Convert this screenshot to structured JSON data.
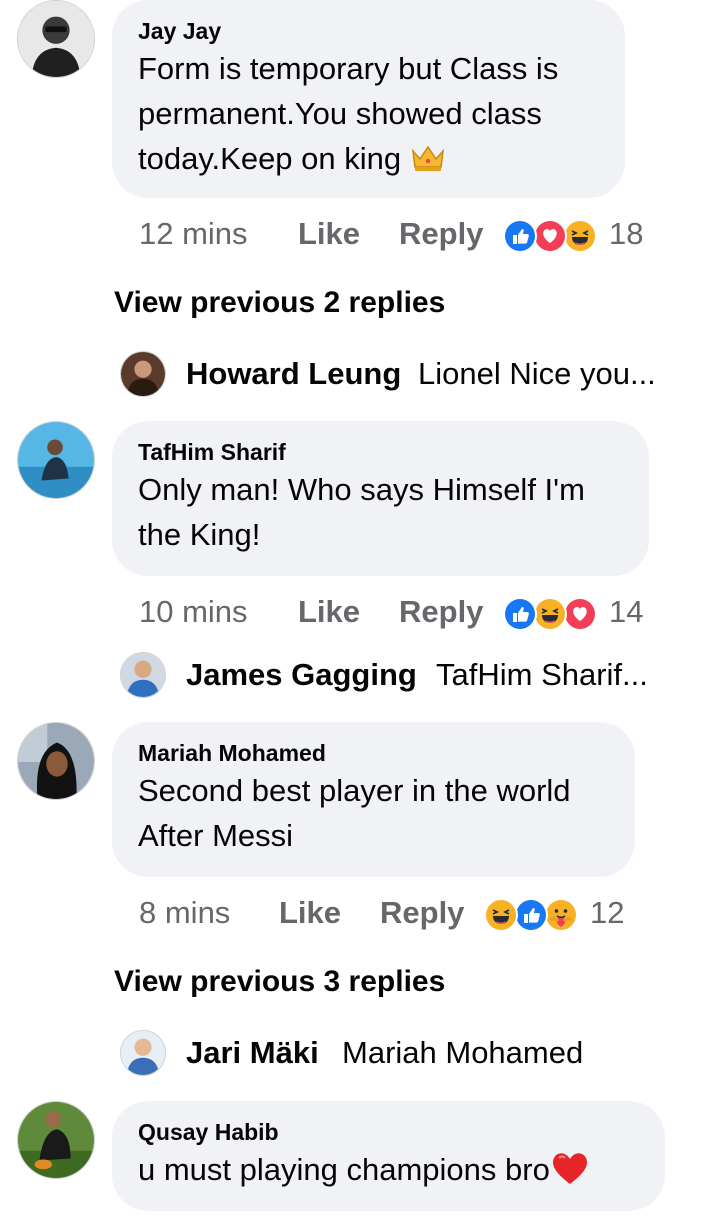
{
  "comments": [
    {
      "author": "Jay Jay",
      "text_lines": [
        "Form is temporary but Class is",
        "permanent.You showed class",
        "today.Keep on king"
      ],
      "emoji": "crown",
      "time": "12 mins",
      "like": "Like",
      "reply": "Reply",
      "reactions": [
        "like",
        "love",
        "haha"
      ],
      "reaction_count": "18"
    },
    {
      "author": "TafHim Sharif",
      "text_lines": [
        "Only man! Who says Himself I'm",
        "the King!"
      ],
      "time": "10 mins",
      "like": "Like",
      "reply": "Reply",
      "reactions": [
        "like",
        "haha",
        "love"
      ],
      "reaction_count": "14"
    },
    {
      "author": "Mariah Mohamed",
      "text_lines": [
        "Second best player in the world",
        "After Messi"
      ],
      "time": "8 mins",
      "like": "Like",
      "reply": "Reply",
      "reactions": [
        "haha",
        "like",
        "care"
      ],
      "reaction_count": "12"
    },
    {
      "author": "Qusay Habib",
      "text_lines": [
        "u must playing champions bro"
      ],
      "emoji": "red-heart"
    }
  ],
  "view_previous": [
    "View previous 2 replies",
    "View previous 3 replies"
  ],
  "replies": [
    {
      "name": "Howard Leung",
      "preview": "Lionel Nice you..."
    },
    {
      "name": "James Gagging",
      "preview": "TafHim Sharif..."
    },
    {
      "name": "Jari Mäki",
      "preview": "Mariah Mohamed"
    }
  ],
  "colors": {
    "bubble": "#f0f2f5",
    "meta_text": "#65676b",
    "like_blue": "#1877f2",
    "love_red": "#f33e58",
    "haha_yellow": "#f7b125"
  }
}
